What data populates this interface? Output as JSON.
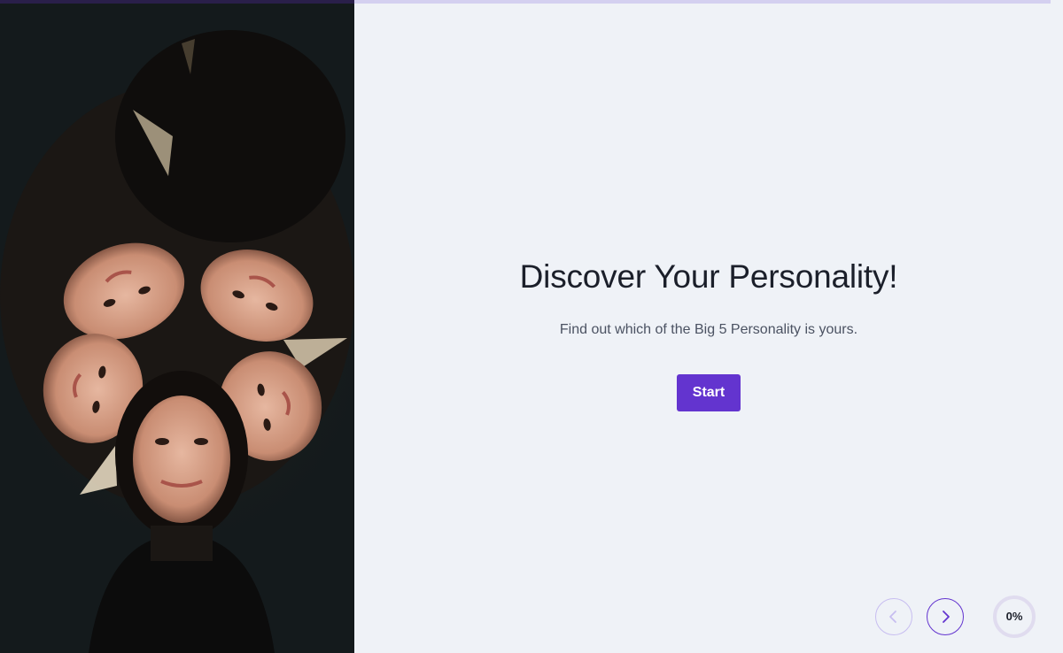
{
  "hero": {
    "title": "Discover Your Personality!",
    "subtitle": "Find out which of the Big 5 Personality is yours.",
    "start_label": "Start",
    "image_alt": "Five faces arranged in a circle"
  },
  "navigation": {
    "prev_icon": "chevron-left-icon",
    "next_icon": "chevron-right-icon",
    "progress_label": "0%",
    "progress_value": 0
  },
  "colors": {
    "accent": "#6334cf",
    "background": "#eff2f7",
    "photo_background": "#141a1c",
    "title": "#1b1f2a",
    "subtitle": "#4b5262"
  }
}
